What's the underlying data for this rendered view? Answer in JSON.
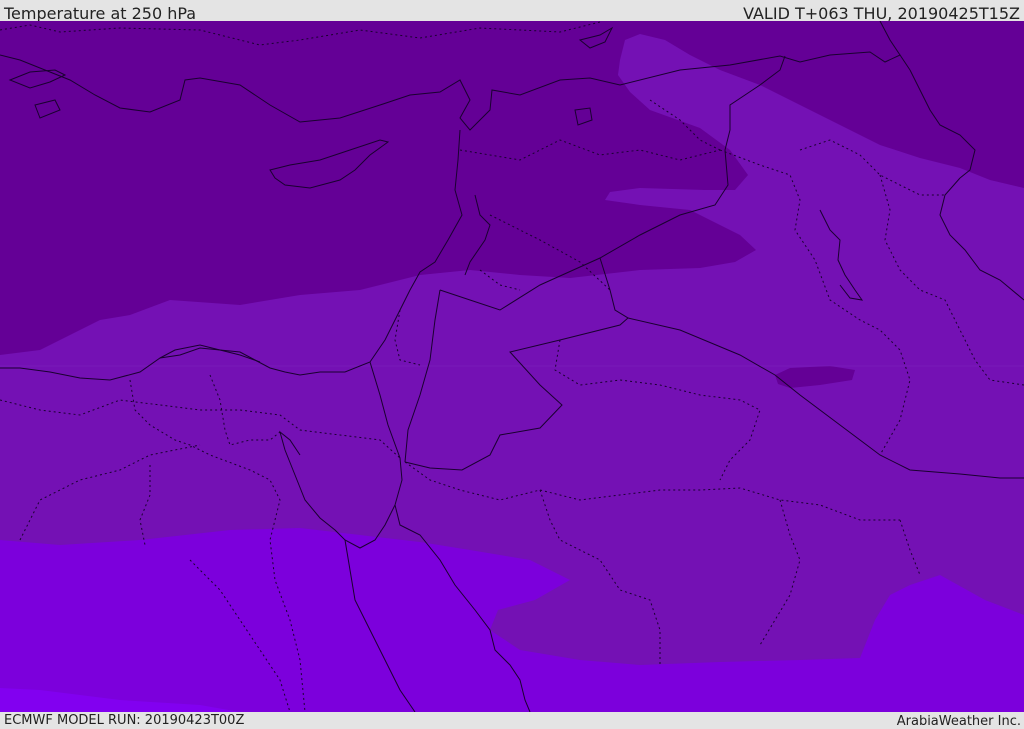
{
  "header": {
    "title": "Temperature at 250 hPa",
    "valid": "VALID T+063 THU, 20190425T15Z"
  },
  "footer": {
    "model_run": "ECMWF MODEL RUN: 20190423T00Z",
    "credit": "ArabiaWeather Inc."
  },
  "map": {
    "temperature_band_colors": [
      "#640096",
      "#7411b4",
      "#7c00dc",
      "#8200f0"
    ],
    "border_color": "#1a0030"
  }
}
